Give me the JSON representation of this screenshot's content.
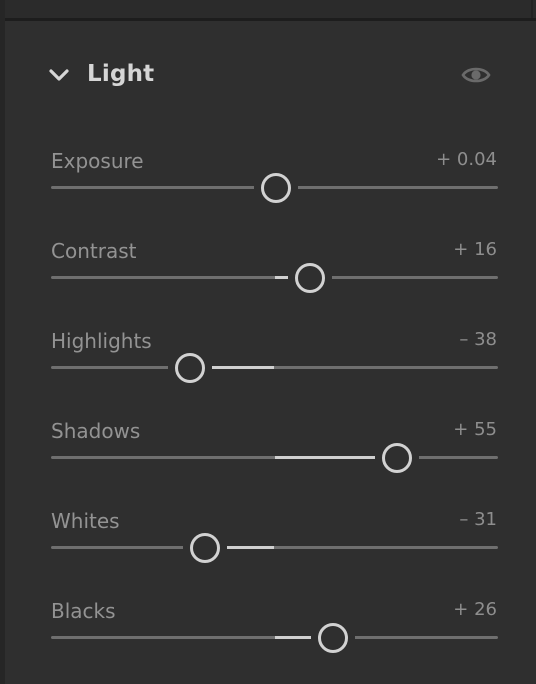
{
  "panel": {
    "section_title": "Light",
    "chevron_icon": "chevron-down-icon",
    "visibility_icon": "eye-icon"
  },
  "sliders": [
    {
      "label": "Exposure",
      "value_text": "+ 0.04",
      "value": 0.04,
      "min": -5,
      "max": 5
    },
    {
      "label": "Contrast",
      "value_text": "+ 16",
      "value": 16,
      "min": -100,
      "max": 100
    },
    {
      "label": "Highlights",
      "value_text": "– 38",
      "value": -38,
      "min": -100,
      "max": 100
    },
    {
      "label": "Shadows",
      "value_text": "+ 55",
      "value": 55,
      "min": -100,
      "max": 100
    },
    {
      "label": "Whites",
      "value_text": "– 31",
      "value": -31,
      "min": -100,
      "max": 100
    },
    {
      "label": "Blacks",
      "value_text": "+ 26",
      "value": 26,
      "min": -100,
      "max": 100
    }
  ],
  "colors": {
    "panel_bg": "#2f2f2f",
    "track": "#6f6f6f",
    "fill": "#d0d0d0",
    "thumb_ring": "#d2d2d2"
  }
}
